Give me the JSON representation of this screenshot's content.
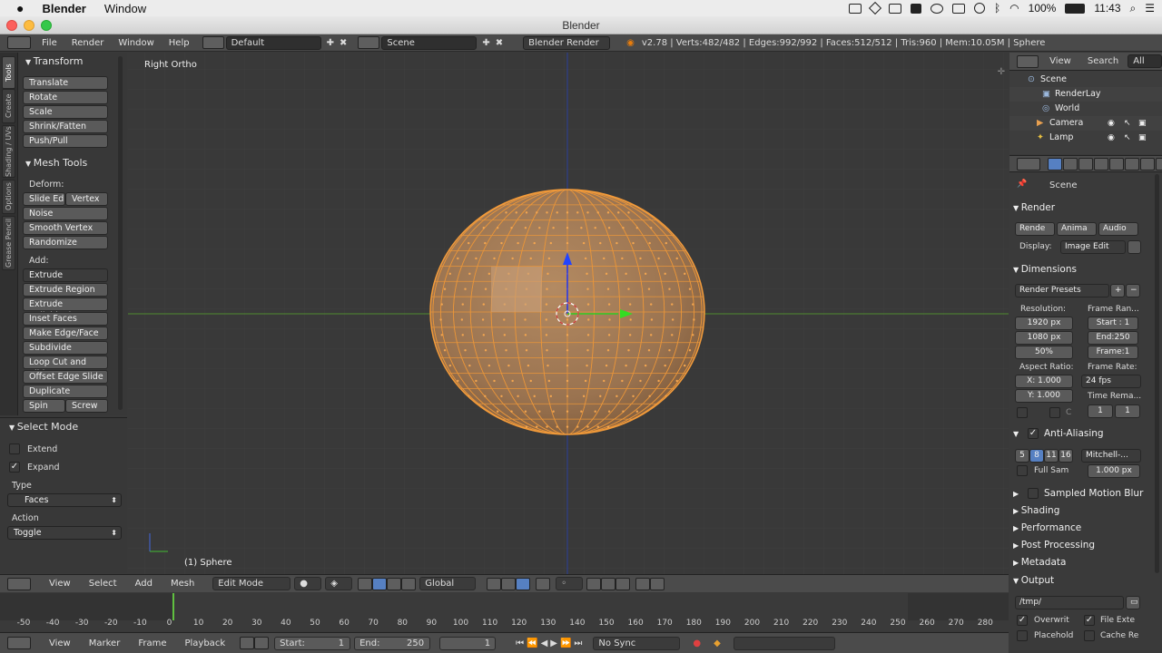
{
  "macbar": {
    "app": "Blender",
    "menu": "Window",
    "battery": "100%",
    "time": "11:43"
  },
  "window": {
    "title": "Blender"
  },
  "infobar": {
    "menus": [
      "File",
      "Render",
      "Window",
      "Help"
    ],
    "layout": "Default",
    "scene": "Scene",
    "engine": "Blender Render",
    "stats": "v2.78 | Verts:482/482 | Edges:992/992 | Faces:512/512 | Tris:960 | Mem:10.05M | Sphere"
  },
  "tool_tabs": [
    "Tools",
    "Create",
    "Shading / UVs",
    "Options",
    "Grease Pencil"
  ],
  "transform": {
    "title": "Transform",
    "buttons": [
      "Translate",
      "Rotate",
      "Scale",
      "Shrink/Fatten",
      "Push/Pull"
    ]
  },
  "mesh_tools": {
    "title": "Mesh Tools",
    "deform_label": "Deform:",
    "slide_edge": "Slide Ed",
    "vertex": "Vertex",
    "deform": [
      "Noise",
      "Smooth Vertex",
      "Randomize"
    ],
    "add_label": "Add:",
    "extrude": "Extrude",
    "add": [
      "Extrude Region",
      "Extrude Individual",
      "Inset Faces",
      "Make Edge/Face",
      "Subdivide",
      "Loop Cut and Slide",
      "Offset Edge Slide",
      "Duplicate"
    ],
    "spin": "Spin",
    "screw": "Screw"
  },
  "operator": {
    "title": "Select Mode",
    "extend": "Extend",
    "expand": "Expand",
    "type_label": "Type",
    "type_value": "Faces",
    "action_label": "Action",
    "action_value": "Toggle"
  },
  "viewport": {
    "view_name": "Right Ortho",
    "object_name": "(1) Sphere"
  },
  "view3d_header": {
    "menus": [
      "View",
      "Select",
      "Add",
      "Mesh"
    ],
    "mode": "Edit Mode",
    "orientation": "Global"
  },
  "timeline": {
    "ticks": [
      "-50",
      "-40",
      "-30",
      "-20",
      "-10",
      "0",
      "10",
      "20",
      "30",
      "40",
      "50",
      "60",
      "70",
      "80",
      "90",
      "100",
      "110",
      "120",
      "130",
      "140",
      "150",
      "160",
      "170",
      "180",
      "190",
      "200",
      "210",
      "220",
      "230",
      "240",
      "250",
      "260",
      "270",
      "280"
    ],
    "current_frame": 1,
    "menus": [
      "View",
      "Marker",
      "Frame",
      "Playback"
    ],
    "start_label": "Start:",
    "start": "1",
    "end_label": "End:",
    "end": "250",
    "current": "1",
    "sync": "No Sync"
  },
  "outliner": {
    "menus": [
      "View",
      "Search"
    ],
    "filter": "All Scen",
    "items": [
      "Scene",
      "RenderLay",
      "World",
      "Camera",
      "Lamp"
    ]
  },
  "properties": {
    "context": "Scene",
    "render": {
      "title": "Render",
      "buttons": [
        "Rende",
        "Anima",
        "Audio"
      ],
      "display_label": "Display:",
      "display": "Image Edit"
    },
    "dimensions": {
      "title": "Dimensions",
      "presets": "Render Presets",
      "resolution_label": "Resolution:",
      "res_x": "1920 px",
      "res_y": "1080 px",
      "res_pct": "50%",
      "frame_range_label": "Frame Ran...",
      "start": "Start : 1",
      "end": "End:250",
      "frame": "Frame:1",
      "aspect_label": "Aspect Ratio:",
      "aspect_x": "X: 1.000",
      "aspect_y": "Y: 1.000",
      "frame_rate_label": "Frame Rate:",
      "fps": "24 fps",
      "time_remap_label": "Time Rema...",
      "remap_old": "1",
      "remap_new": "1",
      "crop_c": "C"
    },
    "aa": {
      "title": "Anti-Aliasing",
      "samples": [
        "5",
        "8",
        "11",
        "16"
      ],
      "filter": "Mitchell-...",
      "full_sample": "Full Sam",
      "filter_size": "1.000 px"
    },
    "collapsed_panels": [
      "Sampled Motion Blur",
      "Shading",
      "Performance",
      "Post Processing",
      "Metadata"
    ],
    "output": {
      "title": "Output",
      "path": "/tmp/",
      "overwrite": "Overwrit",
      "file_ext": "File Exte",
      "placeholder": "Placehold",
      "cache": "Cache Re"
    }
  },
  "colors": {
    "accent_orange": "#f39b3a",
    "selection_blue": "#5680c2",
    "bg": "#393939"
  }
}
